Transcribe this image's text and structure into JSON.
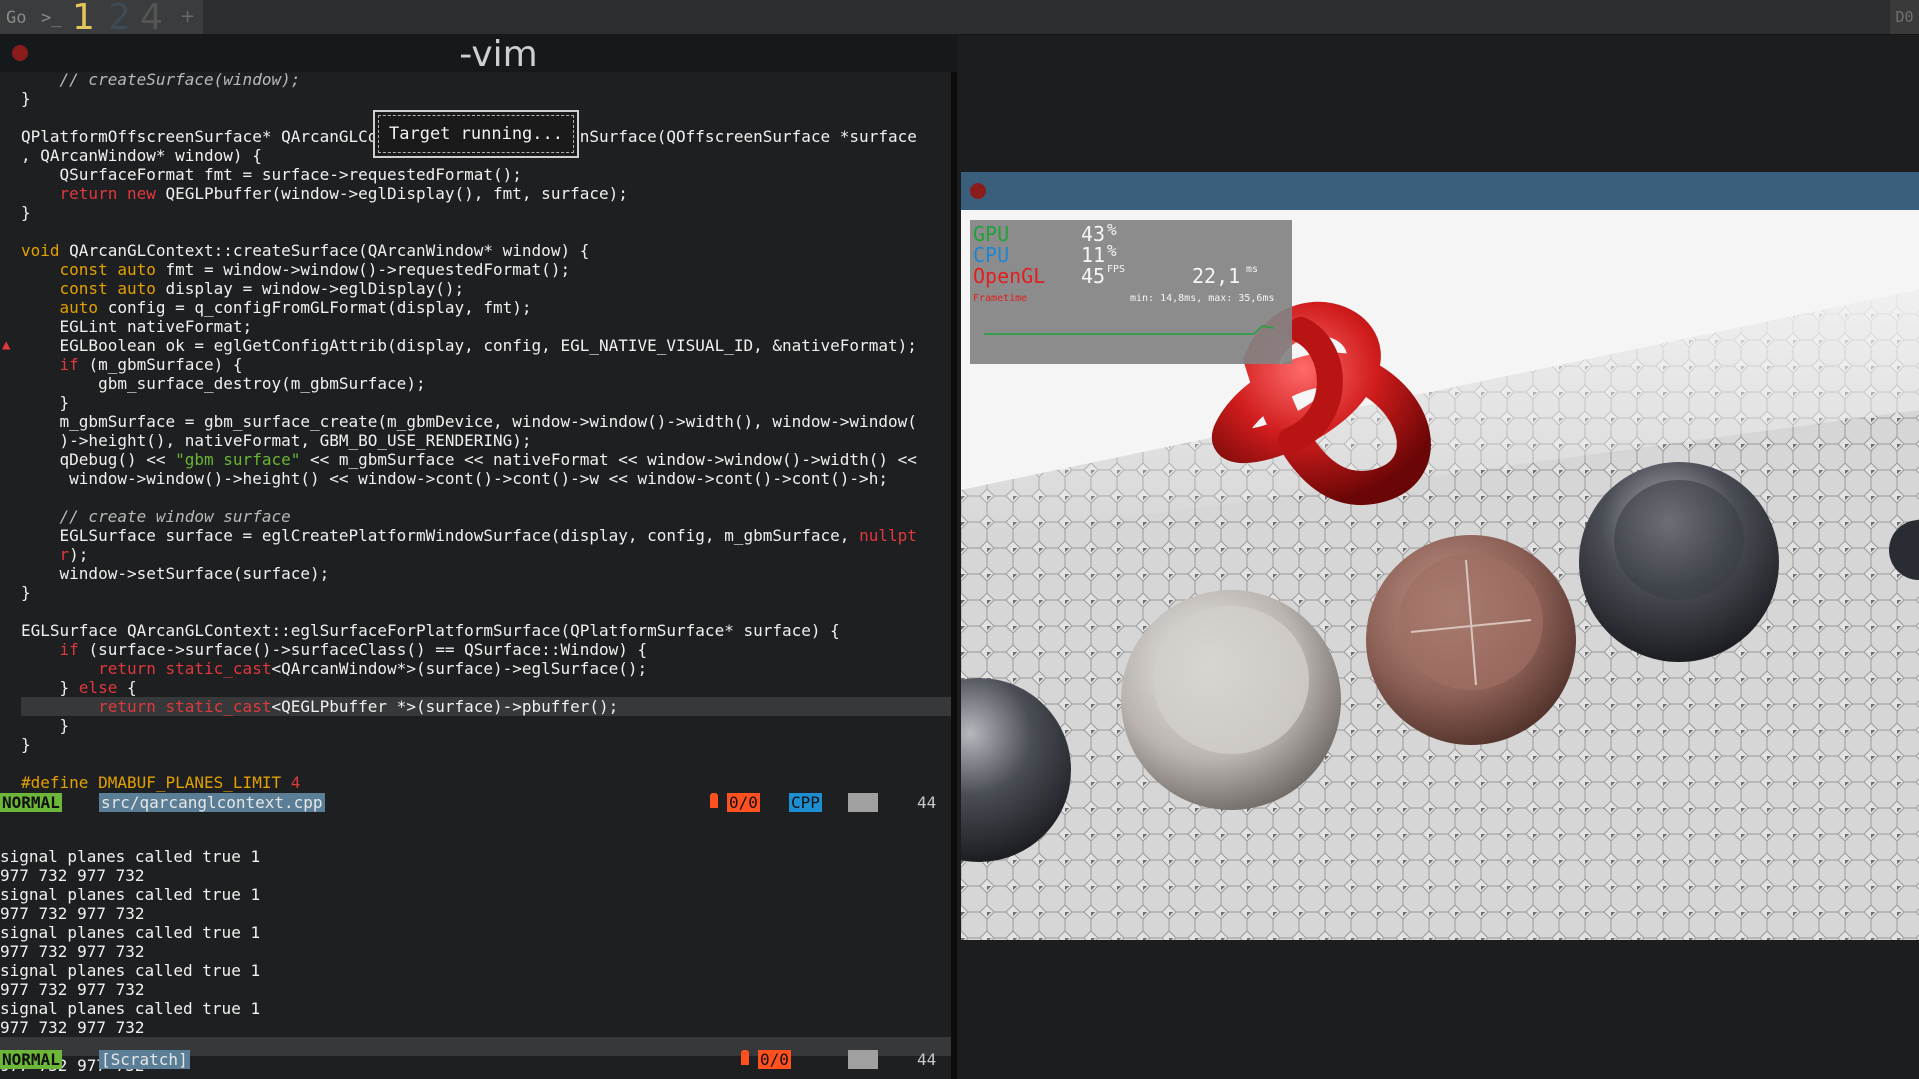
{
  "topbar": {
    "go_label": "Go",
    "prompt_icon": "terminal-prompt-icon",
    "workspaces": [
      {
        "label": "1",
        "color": "#e6c45c"
      },
      {
        "label": "2",
        "color": "#3e4a54"
      },
      {
        "label": "4",
        "color": "#555555"
      }
    ],
    "add_icon": "plus-icon",
    "right_label": "D0"
  },
  "vim_window": {
    "title": "-vim",
    "close_icon": "close-dot-icon",
    "popup": "Target running...",
    "code_lines": [
      [
        {
          "c": "cm",
          "t": "    // createSurface(window);"
        }
      ],
      [
        {
          "c": "",
          "t": "}"
        }
      ],
      [
        {
          "c": "",
          "t": ""
        }
      ],
      [
        {
          "c": "",
          "t": "QPlatformOffscreenSurface* QArcanGLContext::createOffscreenSurface(QOffscreenSurface *surface"
        }
      ],
      [
        {
          "c": "",
          "t": ", QArcanWindow* window) {"
        }
      ],
      [
        {
          "c": "",
          "t": "    QSurfaceFormat fmt = surface->requestedFormat();"
        }
      ],
      [
        {
          "c": "kw",
          "t": "    return new "
        },
        {
          "c": "",
          "t": "QEGLPbuffer(window->eglDisplay(), fmt, surface);"
        }
      ],
      [
        {
          "c": "",
          "t": "}"
        }
      ],
      [
        {
          "c": "",
          "t": ""
        }
      ],
      [
        {
          "c": "ty",
          "t": "void "
        },
        {
          "c": "",
          "t": "QArcanGLContext::createSurface(QArcanWindow* window) {"
        }
      ],
      [
        {
          "c": "ty",
          "t": "    const auto "
        },
        {
          "c": "",
          "t": "fmt = window->window()->requestedFormat();"
        }
      ],
      [
        {
          "c": "ty",
          "t": "    const auto "
        },
        {
          "c": "",
          "t": "display = window->eglDisplay();"
        }
      ],
      [
        {
          "c": "ty",
          "t": "    auto "
        },
        {
          "c": "",
          "t": "config = q_configFromGLFormat(display, fmt);"
        }
      ],
      [
        {
          "c": "",
          "t": "    EGLint nativeFormat;"
        }
      ],
      [
        {
          "c": "",
          "t": "    EGLBoolean ok = eglGetConfigAttrib(display, config, EGL_NATIVE_VISUAL_ID, &nativeFormat);"
        }
      ],
      [
        {
          "c": "kw",
          "t": "    if "
        },
        {
          "c": "",
          "t": "(m_gbmSurface) {"
        }
      ],
      [
        {
          "c": "",
          "t": "        gbm_surface_destroy(m_gbmSurface);"
        }
      ],
      [
        {
          "c": "",
          "t": "    }"
        }
      ],
      [
        {
          "c": "",
          "t": "    m_gbmSurface = gbm_surface_create(m_gbmDevice, window->window()->width(), window->window("
        }
      ],
      [
        {
          "c": "",
          "t": "    )->height(), nativeFormat, GBM_BO_USE_RENDERING);"
        }
      ],
      [
        {
          "c": "",
          "t": "    qDebug() << "
        },
        {
          "c": "st",
          "t": "\"gbm surface\""
        },
        {
          "c": "",
          "t": " << m_gbmSurface << nativeFormat << window->window()->width() <<"
        }
      ],
      [
        {
          "c": "",
          "t": "     window->window()->height() << window->cont()->cont()->w << window->cont()->cont()->h;"
        }
      ],
      [
        {
          "c": "",
          "t": ""
        }
      ],
      [
        {
          "c": "cm",
          "t": "    // create window surface"
        }
      ],
      [
        {
          "c": "",
          "t": "    EGLSurface surface = eglCreatePlatformWindowSurface(display, config, m_gbmSurface, "
        },
        {
          "c": "kw",
          "t": "nullpt"
        }
      ],
      [
        {
          "c": "kw",
          "t": "    r"
        },
        {
          "c": "",
          "t": ");"
        }
      ],
      [
        {
          "c": "",
          "t": "    window->setSurface(surface);"
        }
      ],
      [
        {
          "c": "",
          "t": "}"
        }
      ],
      [
        {
          "c": "",
          "t": ""
        }
      ],
      [
        {
          "c": "",
          "t": "EGLSurface QArcanGLContext::eglSurfaceForPlatformSurface(QPlatformSurface* surface) {"
        }
      ],
      [
        {
          "c": "kw",
          "t": "    if "
        },
        {
          "c": "",
          "t": "(surface->surface()->surfaceClass() == QSurface::Window) {"
        }
      ],
      [
        {
          "c": "kw",
          "t": "        return static_cast"
        },
        {
          "c": "",
          "t": "<QArcanWindow*>(surface)->eglSurface();"
        }
      ],
      [
        {
          "c": "",
          "t": "    } "
        },
        {
          "c": "kw",
          "t": "else "
        },
        {
          "c": "",
          "t": "{"
        }
      ],
      [
        {
          "c": "kw",
          "t": "        return static_cast"
        },
        {
          "c": "",
          "t": "<QEGLPbuffer *>(surface)->pbuffer();"
        }
      ],
      [
        {
          "c": "",
          "t": "    }"
        }
      ],
      [
        {
          "c": "",
          "t": "}"
        }
      ],
      [
        {
          "c": "",
          "t": ""
        }
      ],
      [
        {
          "c": "ty",
          "t": "#define DMABUF_PLANES_LIMIT "
        },
        {
          "c": "nm",
          "t": "4"
        }
      ]
    ],
    "status_top": {
      "mode": "NORMAL",
      "file": "src/qarcanglcontext.cpp",
      "errors": "0/0",
      "filetype": "CPP",
      "column": "44"
    },
    "messages": [
      "signal planes called true 1",
      "977 732 977 732",
      "signal planes called true 1",
      "977 732 977 732",
      "signal planes called true 1",
      "977 732 977 732",
      "signal planes called true 1",
      "977 732 977 732",
      "signal planes called true 1",
      "977 732 977 732",
      "signal planes called true 1",
      "977 732 977 732"
    ],
    "status_bottom": {
      "mode": "NORMAL",
      "file": "[Scratch]",
      "errors": "0/0",
      "column": "44"
    }
  },
  "app_window": {
    "close_icon": "close-dot-icon",
    "perf_overlay": {
      "gpu_label": "GPU",
      "gpu_value": "43",
      "gpu_unit": "%",
      "cpu_label": "CPU",
      "cpu_value": "11",
      "cpu_unit": "%",
      "gl_label": "OpenGL",
      "fps_value": "45",
      "fps_unit": "FPS",
      "frametime_value": "22,1",
      "frametime_unit": "ms",
      "frametime_label": "Frametime",
      "frametime_stats": "min: 14,8ms, max: 35,6ms"
    }
  }
}
